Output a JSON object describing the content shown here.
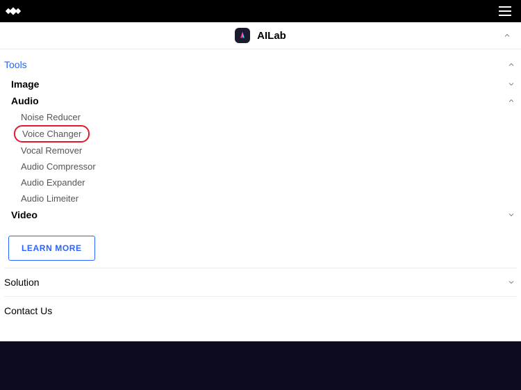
{
  "header": {
    "app_title": "AILab"
  },
  "tools": {
    "label": "Tools",
    "groups": {
      "image": {
        "label": "Image"
      },
      "audio": {
        "label": "Audio",
        "items": [
          "Noise Reducer",
          "Voice Changer",
          "Vocal Remover",
          "Audio Compressor",
          "Audio Expander",
          "Audio Limeiter"
        ]
      },
      "video": {
        "label": "Video"
      }
    }
  },
  "learn_more": "LEARN MORE",
  "solution": {
    "label": "Solution"
  },
  "contact": {
    "label": "Contact Us"
  }
}
